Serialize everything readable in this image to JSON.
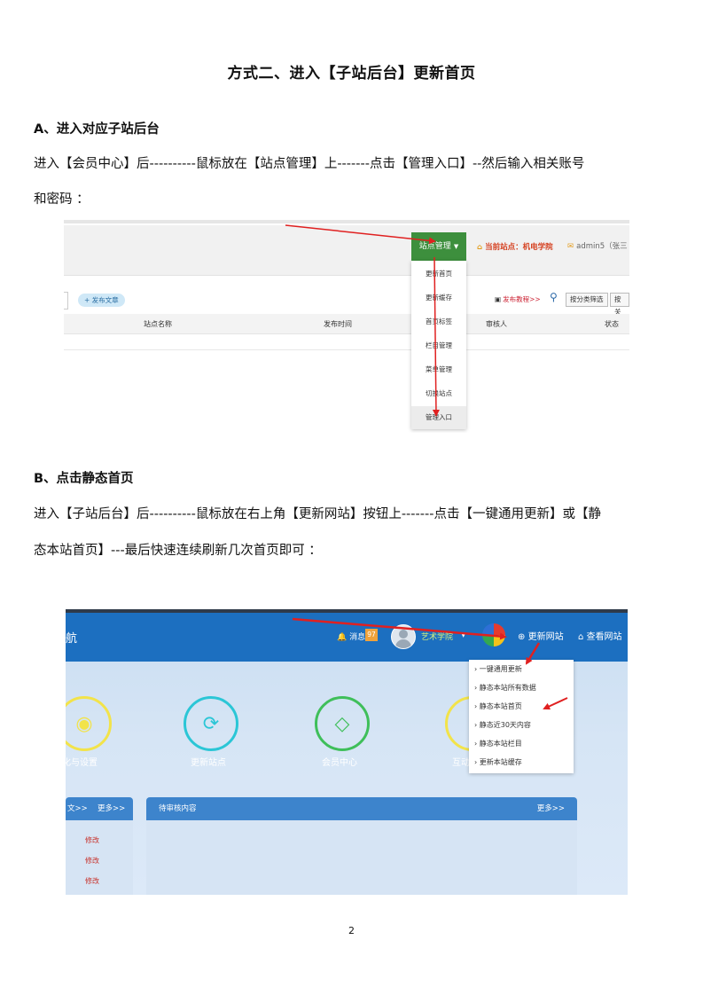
{
  "title": "方式二、进入【子站后台】更新首页",
  "section_a": {
    "heading": "A、进入对应子站后台",
    "line1": "进入【会员中心】后----------鼠标放在【站点管理】上-------点击【管理入口】--然后输入相关账号",
    "line2": "和密码 ："
  },
  "shot1": {
    "menu_head": "站点管理",
    "current_site": "当前站点：机电学院",
    "admin": "admin5（张三",
    "publish_btn": "+ 发布文章",
    "help": "发布教程>>",
    "btn_filter": "按分类筛选",
    "btn_cut": "按关",
    "col_name": "站点名称",
    "col_time": "发布时间",
    "col_reviewer": "审核人",
    "col_status": "状态",
    "menu_items": [
      "更新首页",
      "更新缓存",
      "首页标签",
      "栏目管理",
      "菜单管理",
      "切换站点",
      "管理入口"
    ]
  },
  "section_b": {
    "heading": "B、点击静态首页",
    "line1": "进入【子站后台】后----------鼠标放在右上角【更新网站】按钮上-------点击【一键通用更新】或【静",
    "line2": "态本站首页】---最后快速连续刷新几次首页即可 ："
  },
  "shot2": {
    "nav_text": "航",
    "messages": "消息",
    "badge": "97",
    "school": "艺术学院",
    "update_site": "更新网站",
    "view_site": "查看网站",
    "dropdown": [
      "一键通用更新",
      "静态本站所有数据",
      "静态本站首页",
      "静态近30天内容",
      "静态本站栏目",
      "更新本站缓存"
    ],
    "icons": [
      {
        "label": "化与设置",
        "color": "#f2e34a"
      },
      {
        "label": "更新站点",
        "color": "#2bc6d6"
      },
      {
        "label": "会员中心",
        "color": "#3fbf5a"
      },
      {
        "label": "互动",
        "color": "#f2e34a"
      }
    ],
    "left_panel_head": "文>>",
    "more": "更多>>",
    "edit": "修改",
    "main_panel_head": "待审核内容"
  },
  "page_number": "2"
}
